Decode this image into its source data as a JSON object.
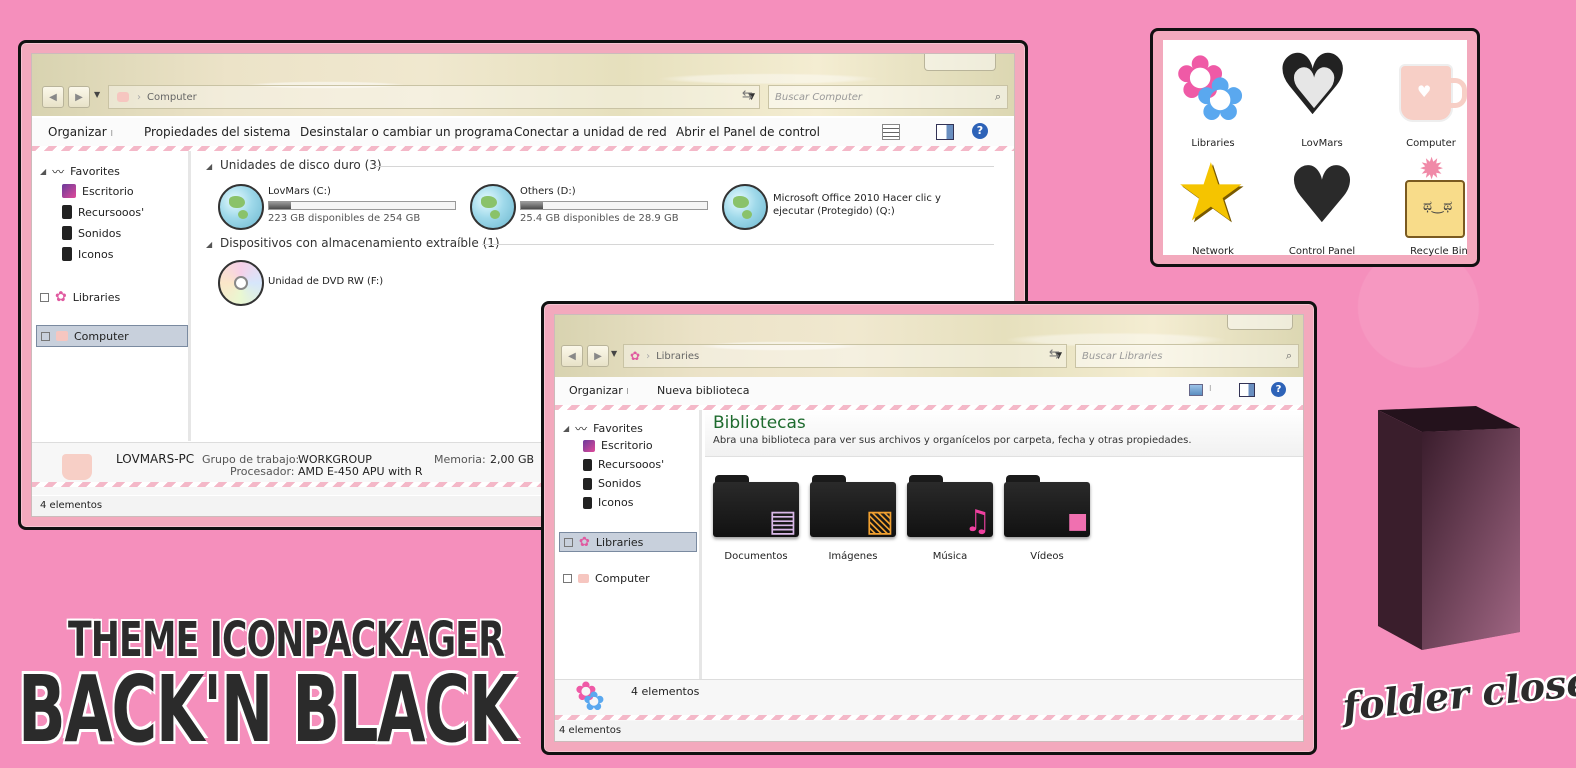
{
  "window1": {
    "breadcrumb": "Computer",
    "search_placeholder": "Buscar Computer",
    "toolbar": {
      "organize": "Organizar",
      "system_props": "Propiedades del sistema",
      "uninstall": "Desinstalar o cambiar un programa",
      "map_drive": "Conectar a unidad de red",
      "control_panel": "Abrir el Panel de control"
    },
    "nav": {
      "favorites": "Favorites",
      "items": [
        "Escritorio",
        "Recursooos'",
        "Sonidos",
        "Iconos"
      ],
      "libraries": "Libraries",
      "computer": "Computer"
    },
    "section_hdd": "Unidades de disco duro (3)",
    "section_removable": "Dispositivos con almacenamiento extraíble (1)",
    "drives": [
      {
        "name": "LovMars (C:)",
        "free": "223 GB disponibles de 254 GB",
        "used_fraction": 0.12
      },
      {
        "name": "Others (D:)",
        "free": "25.4 GB disponibles de 28.9 GB",
        "used_fraction": 0.12
      },
      {
        "name_line1": "Microsoft Office 2010 Hacer clic y",
        "name_line2": "ejecutar (Protegido) (Q:)"
      }
    ],
    "dvd": "Unidad de DVD RW (F:)",
    "details": {
      "pc_name": "LOVMARS-PC",
      "workgroup_label": "Grupo de trabajo:",
      "workgroup_value": "WORKGROUP",
      "memory_label": "Memoria:",
      "memory_value": "2,00 GB",
      "processor_label": "Procesador:",
      "processor_value": "AMD E-450 APU with R"
    },
    "status": "4 elementos"
  },
  "icons_panel": {
    "labels": [
      "Libraries",
      "LovMars",
      "Computer",
      "Network",
      "Control Panel",
      "Recycle Bin"
    ]
  },
  "window2": {
    "breadcrumb": "Libraries",
    "search_placeholder": "Buscar Libraries",
    "toolbar": {
      "organize": "Organizar",
      "new_library": "Nueva biblioteca"
    },
    "nav": {
      "favorites": "Favorites",
      "items": [
        "Escritorio",
        "Recursooos'",
        "Sonidos",
        "Iconos"
      ],
      "libraries": "Libraries",
      "computer": "Computer"
    },
    "heading": "Bibliotecas",
    "subheading": "Abra una biblioteca para ver sus archivos y organícelos por carpeta, fecha y otras propiedades.",
    "folders": [
      "Documentos",
      "Imágenes",
      "Música",
      "Vídeos"
    ],
    "details_count": "4 elementos",
    "status": "4 elementos"
  },
  "titles": {
    "line1": "THEME ICONPACKAGER",
    "line2": "BACK'N BLACK",
    "caption": "folder closed"
  }
}
